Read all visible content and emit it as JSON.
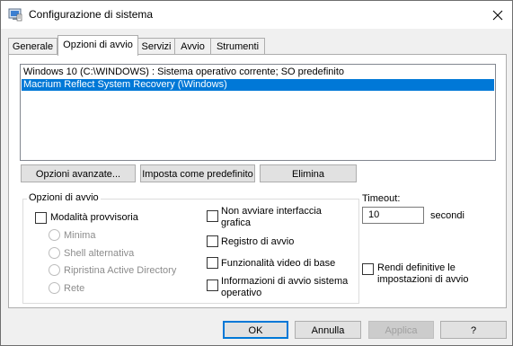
{
  "window": {
    "title": "Configurazione di sistema"
  },
  "tabs": [
    {
      "label": "Generale"
    },
    {
      "label": "Opzioni di avvio"
    },
    {
      "label": "Servizi"
    },
    {
      "label": "Avvio"
    },
    {
      "label": "Strumenti"
    }
  ],
  "boot_list": [
    {
      "text": "Windows 10 (C:\\WINDOWS) : Sistema operativo corrente; SO predefinito",
      "selected": false
    },
    {
      "text": "Macrium Reflect System Recovery (\\Windows)",
      "selected": true
    }
  ],
  "list_buttons": {
    "advanced": "Opzioni avanzate...",
    "set_default": "Imposta come predefinito",
    "delete": "Elimina"
  },
  "boot_options": {
    "group_label": "Opzioni di avvio",
    "safe_boot": {
      "label": "Modalità provvisoria",
      "checked": false
    },
    "radios": [
      {
        "label": "Minima"
      },
      {
        "label": "Shell alternativa"
      },
      {
        "label": "Ripristina Active Directory"
      },
      {
        "label": "Rete"
      }
    ],
    "no_gui": {
      "label": "Non avviare interfaccia grafica",
      "checked": false
    },
    "boot_log": {
      "label": "Registro di avvio",
      "checked": false
    },
    "base_video": {
      "label": "Funzionalità video di base",
      "checked": false
    },
    "os_boot_info": {
      "label": "Informazioni di avvio sistema operativo",
      "checked": false
    }
  },
  "timeout": {
    "label": "Timeout:",
    "value": "10",
    "unit": "secondi"
  },
  "make_permanent": {
    "label": "Rendi definitive le impostazioni di avvio",
    "checked": false
  },
  "footer": {
    "ok": "OK",
    "cancel": "Annulla",
    "apply": "Applica",
    "help": "?"
  },
  "colors": {
    "selection": "#0078d7",
    "titlebar": "#ffffff",
    "face": "#f0f0f0"
  }
}
